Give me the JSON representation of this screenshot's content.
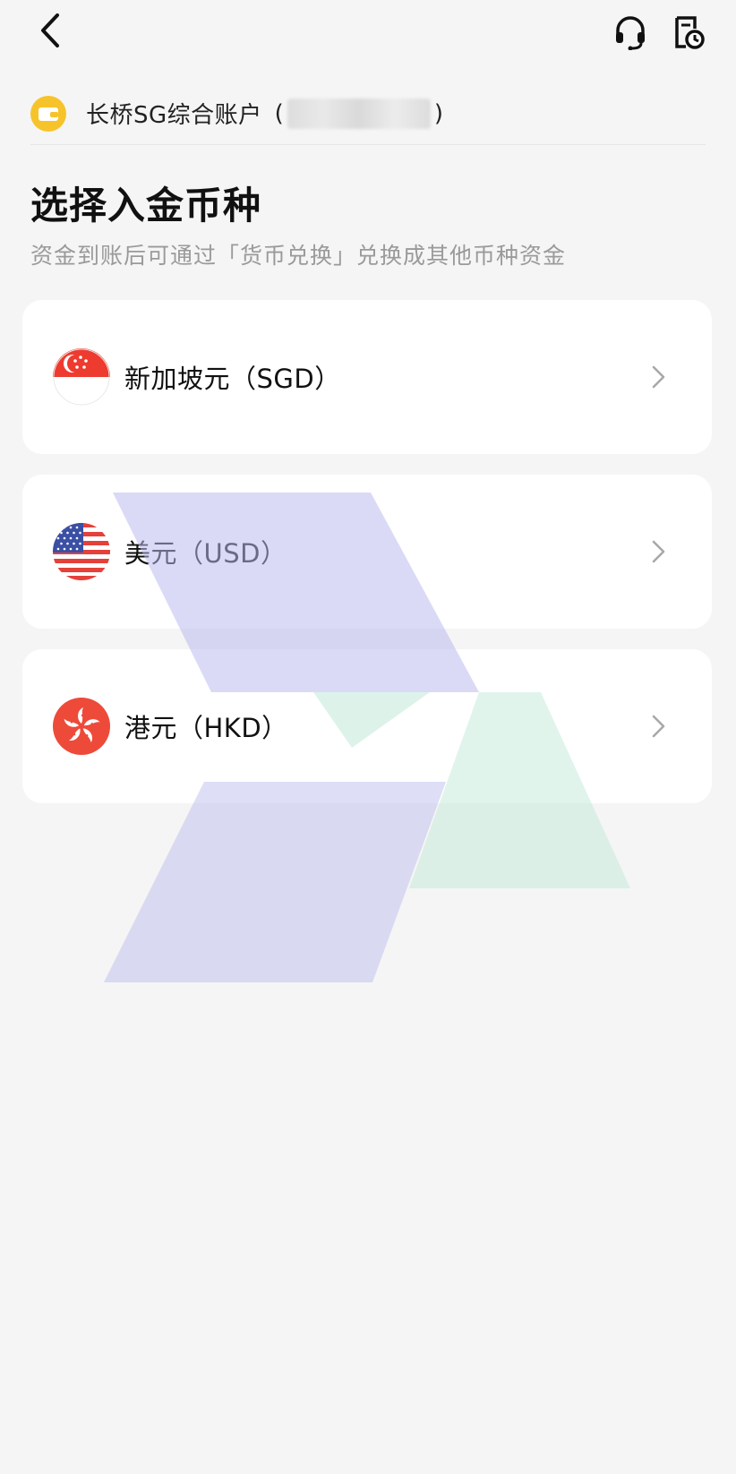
{
  "header": {
    "back_icon": "chevron-left-icon",
    "support_icon": "headset-icon",
    "history_icon": "document-clock-icon"
  },
  "account": {
    "icon": "wallet-icon",
    "icon_color": "#f6c42a",
    "name": "长桥SG综合账户",
    "id_open": "(",
    "id_close": ")"
  },
  "page": {
    "title": "选择入金币种",
    "subtitle": "资金到账后可通过「货币兑换」兑换成其他币种资金"
  },
  "currencies": [
    {
      "label": "新加坡元（SGD）",
      "flag": "singapore-flag-icon"
    },
    {
      "label": "美元（USD）",
      "flag": "us-flag-icon"
    },
    {
      "label": "港元（HKD）",
      "flag": "hong-kong-flag-icon"
    }
  ],
  "colors": {
    "background": "#f5f5f5",
    "card": "#ffffff",
    "subtitle": "#9a9a9a",
    "watermark_blue": "#dcdcf7",
    "watermark_green": "#dff2ea"
  }
}
